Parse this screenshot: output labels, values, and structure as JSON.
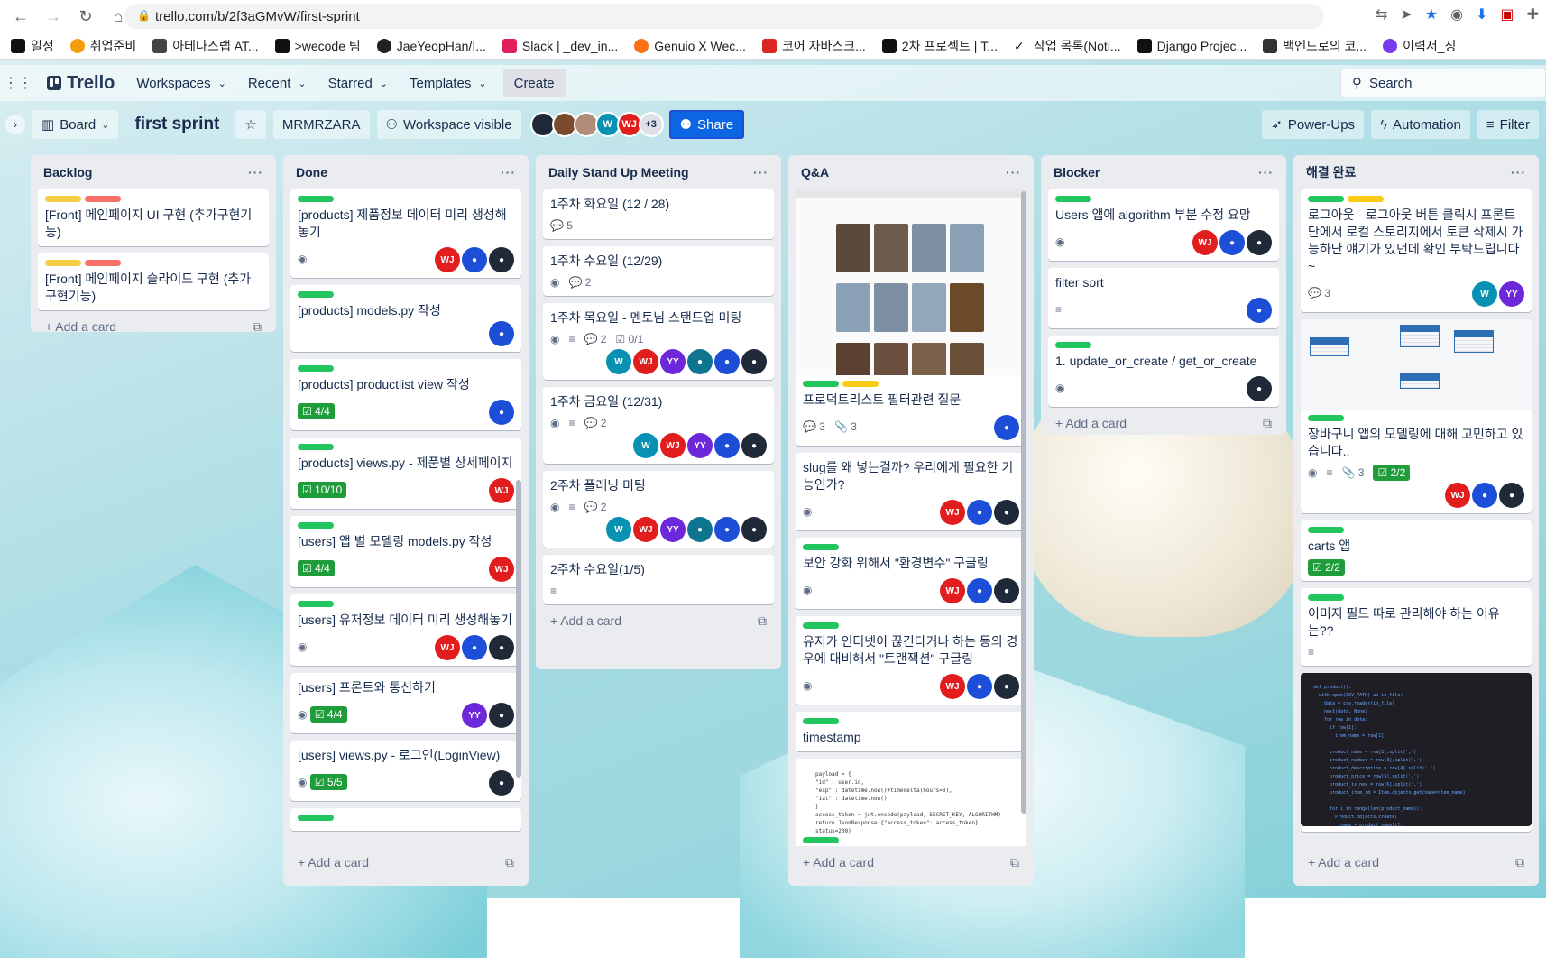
{
  "browser": {
    "url": "trello.com/b/2f3aGMvW/first-sprint",
    "bookmarks": [
      "일정",
      "취업준비",
      "아테나스랩 AT...",
      ">wecode 팀",
      "JaeYeopHan/I...",
      "Slack | _dev_in...",
      "Genuio X Wec...",
      "코어 자바스크...",
      "2차 프로젝트 | T...",
      "작업 목록(Noti...",
      "Django Projec...",
      "백엔드로의 코...",
      "이력서_징"
    ]
  },
  "header": {
    "logo": "Trello",
    "workspaces": "Workspaces",
    "recent": "Recent",
    "starred": "Starred",
    "templates": "Templates",
    "create": "Create",
    "search": "Search"
  },
  "boardbar": {
    "view": "Board",
    "title": "first sprint",
    "workspace": "MRMRZARA",
    "visibility": "Workspace visible",
    "more_members": "+3",
    "share": "Share",
    "powerups": "Power-Ups",
    "automation": "Automation",
    "filter": "Filter"
  },
  "add_card": "Add a card",
  "lists": [
    {
      "title": "Backlog",
      "cards": [
        {
          "labels": [
            "#f5cd47",
            "#f87168"
          ],
          "title": "[Front] 메인페이지 UI 구현 (추가구현기능)"
        },
        {
          "labels": [
            "#f5cd47",
            "#f87168"
          ],
          "title": "[Front] 메인페이지 슬라이드 구현 (추가구현기능)"
        }
      ]
    },
    {
      "title": "Done",
      "cards": [
        {
          "labels": [
            "#22c55e"
          ],
          "title": "[products] 제품정보 데이터 미리 생성해놓기"
        },
        {
          "labels": [
            "#22c55e"
          ],
          "title": "[products] models.py 작성"
        },
        {
          "labels": [
            "#22c55e"
          ],
          "title": "[products] productlist view 작성",
          "checklist": "4/4"
        },
        {
          "labels": [
            "#22c55e"
          ],
          "title": "[products] views.py - 제품별 상세페이지",
          "checklist": "10/10"
        },
        {
          "labels": [
            "#22c55e"
          ],
          "title": "[users] 앱 별 모델링 models.py 작성",
          "checklist": "4/4"
        },
        {
          "labels": [
            "#22c55e"
          ],
          "title": "[users] 유저정보 데이터 미리 생성해놓기"
        },
        {
          "labels": [],
          "title": "[users] 프론트와 통신하기",
          "checklist": "4/4"
        },
        {
          "labels": [],
          "title": "[users] views.py - 로그인(LoginView)",
          "checklist": "5/5"
        }
      ]
    },
    {
      "title": "Daily Stand Up Meeting",
      "cards": [
        {
          "title": "1주차 화요일 (12 / 28)",
          "comments": "5"
        },
        {
          "title": "1주차 수요일 (12/29)",
          "comments": "2"
        },
        {
          "title": "1주차 목요일 - 멘토님 스탠드업 미팅",
          "comments": "2",
          "checklist": "0/1"
        },
        {
          "title": "1주차 금요일 (12/31)",
          "comments": "2"
        },
        {
          "title": "2주차 플래닝 미팅",
          "comments": "2"
        },
        {
          "title": "2주차 수요일(1/5)"
        }
      ]
    },
    {
      "title": "Q&A",
      "cards": [
        {
          "title": "프로덕트리스트 필터관련 질문",
          "comments": "3",
          "attachments": "3"
        },
        {
          "title": "slug를 왜 넣는걸까? 우리에게 필요한 기능인가?"
        },
        {
          "title": "보안 강화 위해서 \"환경변수\" 구글링"
        },
        {
          "title": "유저가 인터넷이 끊긴다거나 하는 등의 경우에 대비해서 \"트랜잭션\" 구글링"
        },
        {
          "title": "timestamp"
        }
      ]
    },
    {
      "title": "Blocker",
      "cards": [
        {
          "title": "Users 앱에 algorithm 부분 수정 요망"
        },
        {
          "title": "filter sort"
        },
        {
          "title": "1. update_or_create / get_or_create"
        }
      ]
    },
    {
      "title": "해결 완료",
      "cards": [
        {
          "title": "로그아웃 - 로그아웃 버튼 클릭시 프론트단에서 로컬 스토리지에서 토큰 삭제시 가능하단 얘기가 있던데 확인 부탁드립니다~",
          "comments": "3"
        },
        {
          "title": "장바구니 앱의 모델링에 대해 고민하고 있습니다..",
          "attachments": "3",
          "checklist": "2/2"
        },
        {
          "title": "carts 앱",
          "checklist": "2/2"
        },
        {
          "title": "이미지 필드 따로 관리해야 하는 이유는??"
        }
      ]
    }
  ],
  "jwt_code": [
    "payload = {",
    "    \"id\"  : user.id,",
    "    \"exp\" : datetime.now()+timedelta(hours=3),",
    "    \"iat\" : datetime.now()",
    "}",
    "access_token = jwt.encode(payload, SECRET_KEY, ALGORITHM)",
    "return JsonResponse({\"access_token\": access_token}, status=200)"
  ],
  "colors": {
    "wj": "#e11d1d",
    "w": "#0891b2",
    "yy": "#6d28d9",
    "blue": "#1d4ed8",
    "dark": "#1f2937",
    "green": "#22c55e",
    "yellow": "#facc15",
    "red": "#f87168"
  }
}
